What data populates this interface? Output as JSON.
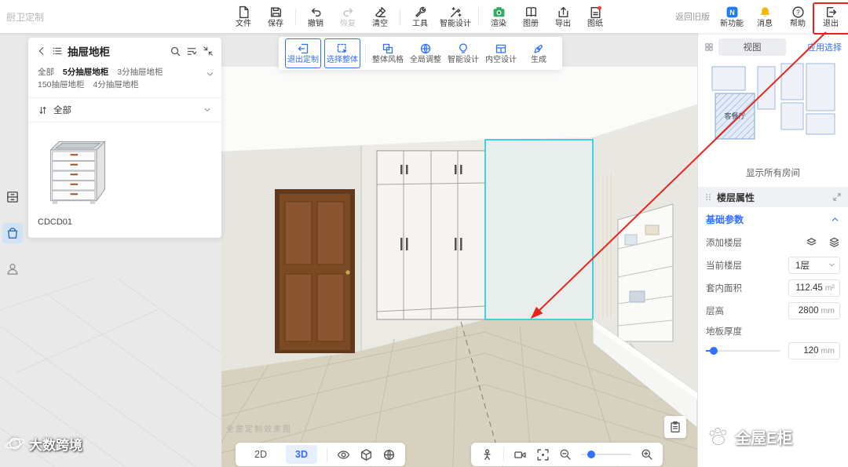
{
  "watermarks": {
    "top_left": "厨卫定制",
    "bottom_left": "大数跨境",
    "bottom_right": "全屋E柜",
    "canvas_faint": "全屋定制效果图"
  },
  "top_toolbar": {
    "items": [
      {
        "label": "文件"
      },
      {
        "label": "保存"
      },
      {
        "label": "撤销"
      },
      {
        "label": "恢复"
      },
      {
        "label": "清空"
      },
      {
        "label": "工具"
      },
      {
        "label": "智能设计"
      },
      {
        "label": "渲染"
      },
      {
        "label": "图册"
      },
      {
        "label": "导出"
      },
      {
        "label": "图纸"
      }
    ],
    "back_link": "返回旧版",
    "right_items": [
      {
        "label": "新功能"
      },
      {
        "label": "消息"
      },
      {
        "label": "帮助"
      },
      {
        "label": "退出"
      }
    ]
  },
  "left_panel": {
    "title": "抽屉地柜",
    "categories": [
      "全部",
      "5分抽屉地柜",
      "3分抽屉地柜",
      "150抽屉地柜",
      "4分抽屉地柜"
    ],
    "active_category": "5分抽屉地柜",
    "filter_value": "全部",
    "product": {
      "name": "CDCD01"
    }
  },
  "canvas_toolbar": {
    "items": [
      {
        "label": "退出定制"
      },
      {
        "label": "选择整体"
      },
      {
        "label": "整体风格"
      },
      {
        "label": "全局调整"
      },
      {
        "label": "智能设计"
      },
      {
        "label": "内空设计"
      },
      {
        "label": "生成"
      }
    ]
  },
  "right_panel": {
    "view_title": "视图",
    "apply_link": "应用选择",
    "selected_room": "客餐厅",
    "show_all_rooms": "显示所有房间",
    "floor_section_title": "楼层属性",
    "basic_params_title": "基础参数",
    "add_floor_label": "添加楼层",
    "current_floor_label": "当前楼层",
    "current_floor_value": "1层",
    "area_label": "套内面积",
    "area_value": "112.45",
    "area_unit": "m²",
    "height_label": "层高",
    "height_value": "2800",
    "height_unit": "mm",
    "thickness_label": "地板厚度",
    "thickness_value": "120",
    "thickness_unit": "mm"
  },
  "bottom_toolbar": {
    "mode_2d": "2D",
    "mode_3d": "3D"
  },
  "colors": {
    "accent_blue": "#3370ff",
    "highlight_cyan": "#3ed3e3",
    "annotation_red": "#e8241d"
  }
}
